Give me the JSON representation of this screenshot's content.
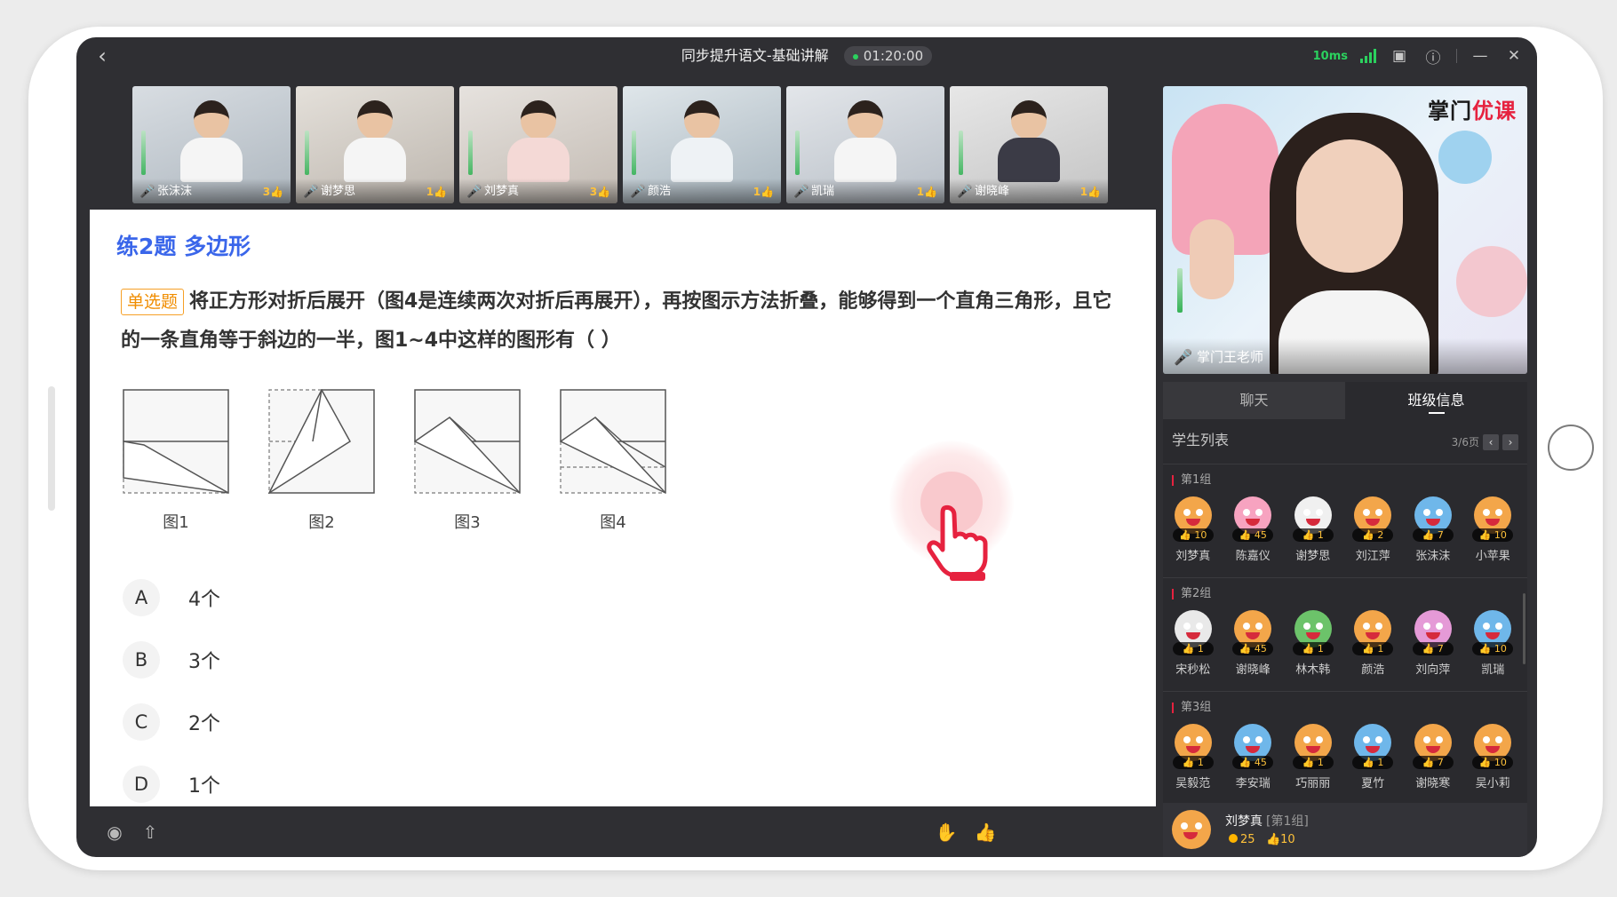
{
  "window": {
    "title": "同步提升语文-基础讲解",
    "timer": "01:20:00",
    "latency": "10ms"
  },
  "students_video": [
    {
      "name": "张沫沫",
      "likes": "3"
    },
    {
      "name": "谢梦思",
      "likes": "1"
    },
    {
      "name": "刘梦真",
      "likes": "3"
    },
    {
      "name": "颜浩",
      "likes": "1"
    },
    {
      "name": "凯瑞",
      "likes": "1"
    },
    {
      "name": "谢晓峰",
      "likes": "1"
    }
  ],
  "teacher": {
    "name": "掌门王老师",
    "logo_part1": "掌门",
    "logo_part2": "优课"
  },
  "question": {
    "title": "练2题 多边形",
    "type": "单选题",
    "text": "将正方形对折后展开（图4是连续两次对折后再展开），再按图示方法折叠，能够得到一个直角三角形，且它的一条直角等于斜边的一半，图1~4中这样的图形有（  ）",
    "figures": [
      "图1",
      "图2",
      "图3",
      "图4"
    ],
    "options": [
      {
        "letter": "A",
        "text": "4个"
      },
      {
        "letter": "B",
        "text": "3个"
      },
      {
        "letter": "C",
        "text": "2个"
      },
      {
        "letter": "D",
        "text": "1个"
      }
    ]
  },
  "panel": {
    "tabs": [
      "聊天",
      "班级信息"
    ],
    "list_title": "学生列表",
    "page": "3/6页",
    "groups": [
      {
        "label": "第1组",
        "students": [
          {
            "name": "刘梦真",
            "likes": "10",
            "color": "#f3a64a"
          },
          {
            "name": "陈嘉仪",
            "likes": "45",
            "color": "#f7a3c0"
          },
          {
            "name": "谢梦思",
            "likes": "1",
            "color": "#f0f0f0"
          },
          {
            "name": "刘江萍",
            "likes": "2",
            "color": "#f3a64a"
          },
          {
            "name": "张沫沫",
            "likes": "7",
            "color": "#6fb7ea"
          },
          {
            "name": "小苹果",
            "likes": "10",
            "color": "#f3a64a"
          }
        ]
      },
      {
        "label": "第2组",
        "students": [
          {
            "name": "宋秒松",
            "likes": "1",
            "color": "#e9e9e9"
          },
          {
            "name": "谢晓峰",
            "likes": "45",
            "color": "#f3a64a"
          },
          {
            "name": "林木韩",
            "likes": "1",
            "color": "#6cc36a"
          },
          {
            "name": "颜浩",
            "likes": "1",
            "color": "#f3a64a"
          },
          {
            "name": "刘向萍",
            "likes": "7",
            "color": "#e59ad7"
          },
          {
            "name": "凯瑞",
            "likes": "10",
            "color": "#6fb7ea"
          }
        ]
      },
      {
        "label": "第3组",
        "students": [
          {
            "name": "吴毅范",
            "likes": "1",
            "color": "#f3a64a"
          },
          {
            "name": "李安瑞",
            "likes": "45",
            "color": "#6fb7ea"
          },
          {
            "name": "巧丽丽",
            "likes": "1",
            "color": "#f3a64a"
          },
          {
            "name": "夏竹",
            "likes": "1",
            "color": "#6fb7ea"
          },
          {
            "name": "谢晓寒",
            "likes": "7",
            "color": "#f3a64a"
          },
          {
            "name": "吴小莉",
            "likes": "10",
            "color": "#f3a64a"
          }
        ]
      }
    ],
    "me": {
      "name": "刘梦真",
      "group": "[第1组]",
      "coins": "25",
      "likes": "10"
    }
  },
  "colors": {
    "accent_blue": "#3a66ea",
    "brand_red": "#e6223f",
    "signal_green": "#2bd15e"
  },
  "icons": {
    "bottom_left": [
      "eye-icon",
      "shirt-icon"
    ],
    "bottom_right": [
      "raise-hand-icon",
      "thumbs-up-icon"
    ],
    "titlebar": [
      "signal-icon",
      "screen-icon",
      "help-icon",
      "minimize-icon",
      "close-icon"
    ]
  }
}
